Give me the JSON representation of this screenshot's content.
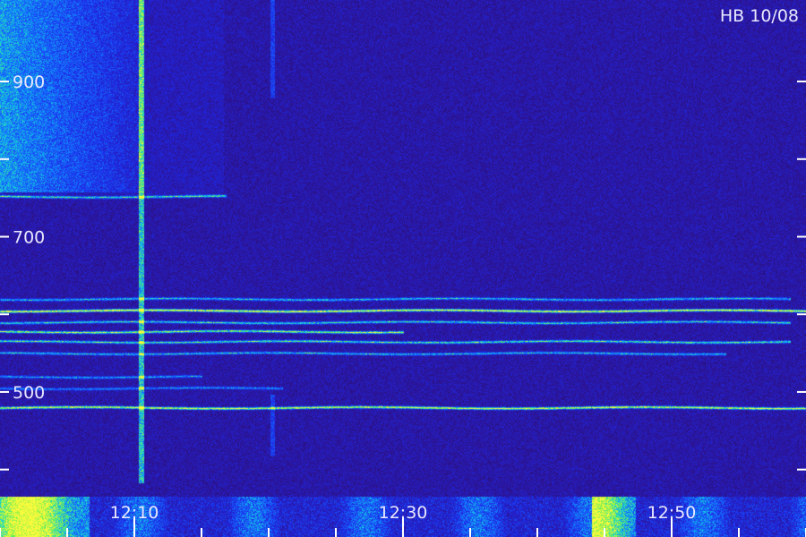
{
  "title": "HB 10/08",
  "chart_data": {
    "type": "heatmap",
    "title": "HB 10/08",
    "y_ticks": [
      900,
      700,
      500
    ],
    "y_minor_ticks": [
      800,
      600,
      400
    ],
    "x_ticks": [
      "12:10",
      "12:30",
      "12:50"
    ],
    "y_range": [
      365,
      1005
    ],
    "x_range_minutes": [
      0,
      60
    ],
    "colormap": "dark purple - blue - cyan - green - yellow",
    "bands": [
      {
        "freq": 752,
        "intensity": 0.55,
        "span": [
          0,
          0.28
        ]
      },
      {
        "freq": 620,
        "intensity": 0.5,
        "span": [
          0,
          0.98
        ]
      },
      {
        "freq": 605,
        "intensity": 0.85,
        "span": [
          0,
          1.0
        ]
      },
      {
        "freq": 590,
        "intensity": 0.55,
        "span": [
          0,
          0.98
        ]
      },
      {
        "freq": 578,
        "intensity": 0.7,
        "span": [
          0,
          0.5
        ]
      },
      {
        "freq": 565,
        "intensity": 0.6,
        "span": [
          0,
          0.98
        ]
      },
      {
        "freq": 550,
        "intensity": 0.5,
        "span": [
          0,
          0.9
        ]
      },
      {
        "freq": 520,
        "intensity": 0.45,
        "span": [
          0,
          0.25
        ]
      },
      {
        "freq": 505,
        "intensity": 0.4,
        "span": [
          0,
          0.35
        ]
      },
      {
        "freq": 480,
        "intensity": 0.8,
        "span": [
          0,
          1.0
        ]
      }
    ]
  }
}
